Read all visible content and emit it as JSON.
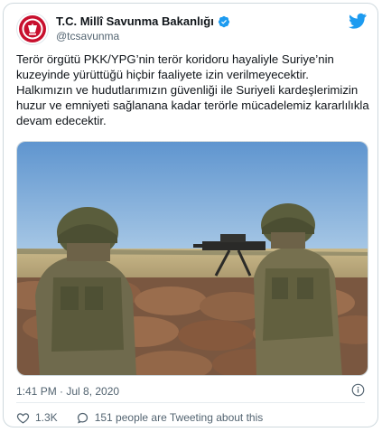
{
  "account": {
    "display_name": "T.C. Millî Savunma Bakanlığı",
    "handle": "@tcsavunma",
    "verified": true,
    "avatar_icon": "ministry-seal-icon"
  },
  "tweet": {
    "paragraph_1": "Terör örgütü PKK/YPG’nin terör koridoru hayaliyle Suriye’nin kuzeyinde yürüttüğü hiçbir faaliyete izin verilmeyecektir.",
    "paragraph_2": "Halkımızın ve hudutlarımızın güvenliği ile Suriyeli kardeşlerimizin huzur ve emniyeti sağlanana kadar terörle mücadelemiz kararlılıkla devam edecektir."
  },
  "media": {
    "type": "photo"
  },
  "meta": {
    "timestamp": "1:41 PM · Jul 8, 2020"
  },
  "actions": {
    "like_count": "1.3K",
    "tweeting_label": "151 people are Tweeting about this"
  },
  "colors": {
    "twitter_blue": "#1d9bf0",
    "verified_blue": "#1d9bf0",
    "like_red": "#f91880",
    "seal_red": "#c8102e",
    "secondary_text": "#536471"
  }
}
